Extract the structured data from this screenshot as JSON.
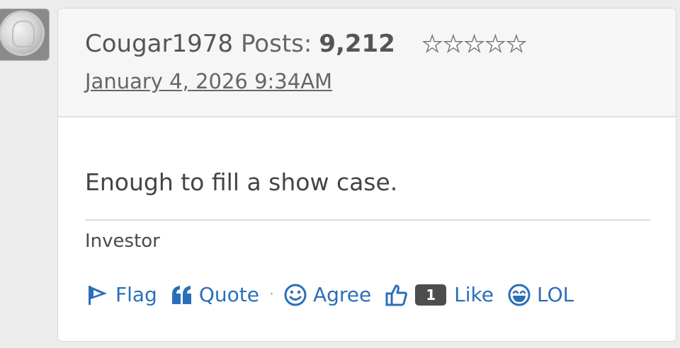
{
  "post": {
    "author": "Cougar1978",
    "posts_label": "Posts:",
    "posts_count": "9,212",
    "stars": "★★★★★",
    "date": "January 4, 2026 9:34AM",
    "body": "Enough to fill a show case.",
    "signature": "Investor"
  },
  "reactions": {
    "flag_label": "Flag",
    "quote_label": "Quote",
    "separator": "·",
    "agree_label": "Agree",
    "like_count": "1",
    "like_label": "Like",
    "lol_label": "LOL"
  },
  "colors": {
    "link": "#2a6fb8",
    "badge": "#4d4d4d",
    "header_bg": "#f6f6f6"
  },
  "icons": [
    "flag-icon",
    "quote-icon",
    "agree-icon",
    "thumbs-up-icon",
    "lol-icon"
  ]
}
